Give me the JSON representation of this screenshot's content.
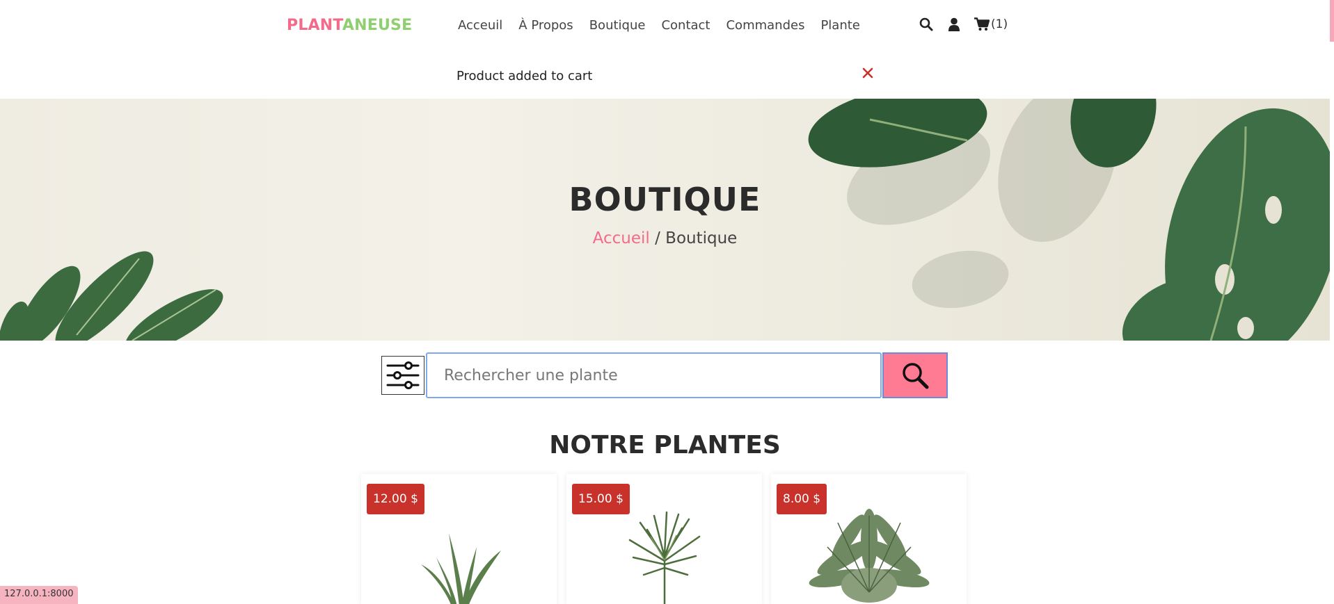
{
  "header": {
    "logo_part1": "PLANT",
    "logo_part2": "ANEUSE",
    "nav": [
      "Acceuil",
      "À Propos",
      "Boutique",
      "Contact",
      "Commandes",
      "Plante"
    ],
    "cart_count": "(1)",
    "icons": [
      "search-icon",
      "user-icon",
      "cart-icon"
    ]
  },
  "notice": {
    "text": "Product added to cart"
  },
  "banner": {
    "title": "BOUTIQUE",
    "breadcrumb_home": "Accueil",
    "breadcrumb_sep": " / ",
    "breadcrumb_current": "Boutique"
  },
  "search": {
    "placeholder": "Rechercher une plante"
  },
  "products": {
    "section_title": "NOTRE PLANTES",
    "items": [
      {
        "price": "12.00 $"
      },
      {
        "price": "15.00 $"
      },
      {
        "price": "8.00 $"
      }
    ]
  },
  "status_bar": {
    "url": "127.0.0.1:8000"
  },
  "colors": {
    "brand_pink": "#f26b8a",
    "brand_green": "#8fcf6f",
    "price_red": "#c8322b",
    "search_button": "#ff7a93"
  }
}
